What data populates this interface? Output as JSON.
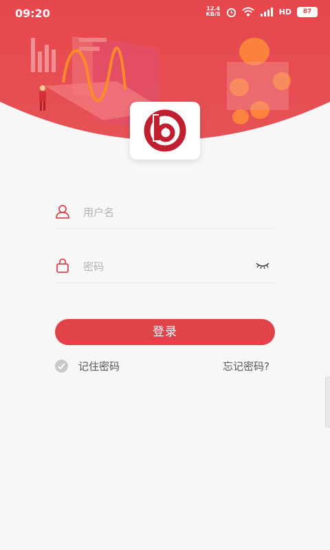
{
  "status_bar": {
    "time": "09:20",
    "net_speed_value": "12.4",
    "net_speed_unit": "KB/S",
    "hd_label": "HD",
    "battery": "87",
    "icons": [
      "alarm-icon",
      "wifi-icon",
      "signal-icon",
      "hd-icon",
      "battery-icon"
    ]
  },
  "login": {
    "username_placeholder": "用户名",
    "password_placeholder": "密码",
    "login_button": "登录",
    "remember_label": "记住密码",
    "forgot_label": "忘记密码?"
  },
  "colors": {
    "brand_red": "#e0434a",
    "logo_red": "#c01f2f",
    "background": "#f7f7f7"
  }
}
